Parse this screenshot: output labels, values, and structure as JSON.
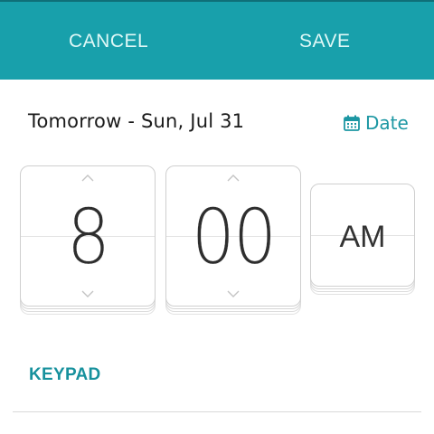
{
  "header": {
    "cancel_label": "CANCEL",
    "save_label": "SAVE"
  },
  "date_row": {
    "label": "Tomorrow - Sun, Jul 31",
    "date_button_label": "Date",
    "date_button_icon": "calendar-icon"
  },
  "time_picker": {
    "hour": "8",
    "minute": "00",
    "meridiem": "AM"
  },
  "keypad_label": "KEYPAD",
  "colors": {
    "accent": "#18a0ab",
    "accent_text": "#1c97a3",
    "header_text": "#dff8f7"
  }
}
